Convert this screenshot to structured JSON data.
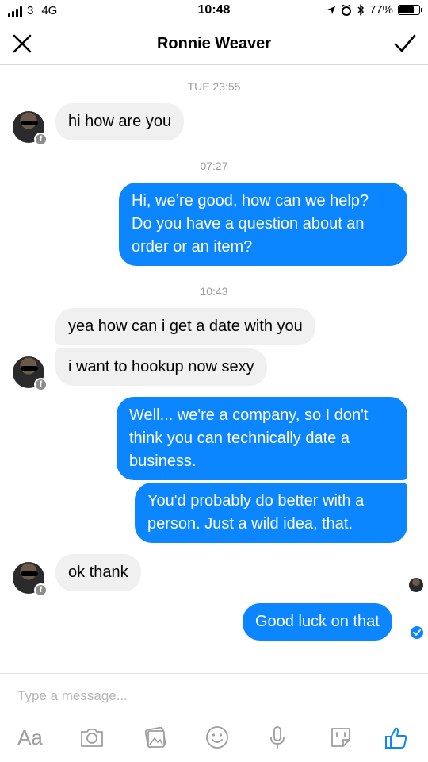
{
  "status_bar": {
    "carrier": "3",
    "network": "4G",
    "time": "10:48",
    "battery": "77%",
    "battery_level": 0.77
  },
  "header": {
    "title": "Ronnie Weaver",
    "close_icon": "close-icon",
    "done_icon": "checkmark-icon"
  },
  "conversation": {
    "timestamps": [
      "TUE 23:55",
      "07:27",
      "10:43"
    ],
    "messages": [
      {
        "from": "them",
        "text": "hi how are you"
      },
      {
        "from": "me",
        "lines": [
          "Hi, we’re good, how can we help?",
          "Do you have a question about an",
          "order or an item?"
        ]
      },
      {
        "from": "them",
        "text": "yea how can i get a date with you"
      },
      {
        "from": "them",
        "text": "i want to hookup now sexy"
      },
      {
        "from": "me",
        "lines": [
          "Well... we're a company, so I don't",
          "think you can technically date a",
          "business."
        ]
      },
      {
        "from": "me",
        "lines": [
          "You'd probably do better with a",
          "person. Just a wild idea, that."
        ]
      },
      {
        "from": "them",
        "text": "ok thank"
      },
      {
        "from": "me",
        "text": "Good luck on that"
      }
    ]
  },
  "composer": {
    "placeholder": "Type a message...",
    "aa_label": "Aa",
    "icons": [
      "aa-icon",
      "camera-icon",
      "gallery-icon",
      "emoji-icon",
      "microphone-icon",
      "sticker-icon",
      "thumbs-up-icon"
    ]
  },
  "colors": {
    "outgoing_bubble": "#0b86ff",
    "incoming_bubble": "#f0f0f0",
    "timestamp": "#9b9b9b"
  }
}
